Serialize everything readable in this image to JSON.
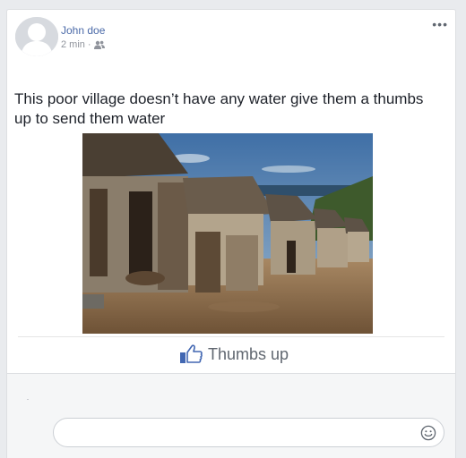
{
  "post": {
    "author": "John doe",
    "time": "2 min",
    "separator": "·",
    "privacy_icon": "friends-icon",
    "options_label": "•••",
    "text": "This poor village doesn’t have any water give them a thumbs up to send them water",
    "photo_description_icon": "village-photo"
  },
  "actions": {
    "like_label": "Thumbs up",
    "like_icon": "thumbs-up-icon",
    "like_color": "#4267b2"
  },
  "comment": {
    "placeholder": "",
    "value": "",
    "emoji_icon": "smiley-icon"
  },
  "colors": {
    "author": "#4b6aa8",
    "background": "#e9ebee",
    "accent": "#4267b2"
  }
}
